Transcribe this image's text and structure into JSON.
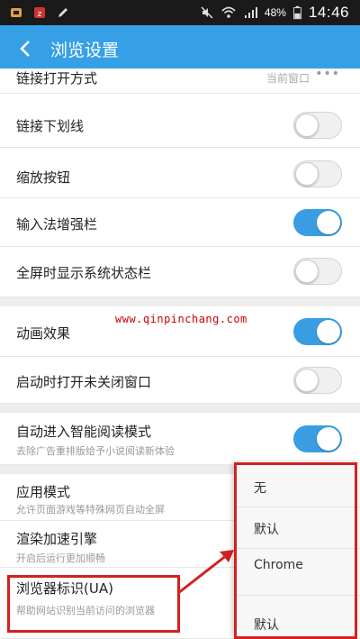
{
  "status_bar": {
    "battery": "48%",
    "time": "14:46"
  },
  "header": {
    "title": "浏览设置"
  },
  "rows": [
    {
      "label": "链接打开方式",
      "value": "当前窗口"
    },
    {
      "label": "链接下划线",
      "toggle": "off"
    },
    {
      "label": "缩放按钮",
      "toggle": "off"
    },
    {
      "label": "输入法增强栏",
      "toggle": "on"
    },
    {
      "label": "全屏时显示系统状态栏",
      "toggle": "off"
    },
    {
      "label": "动画效果",
      "toggle": "on"
    },
    {
      "label": "启动时打开未关闭窗口",
      "toggle": "off"
    },
    {
      "label": "自动进入智能阅读模式",
      "sub": "去除广告重排版给予小说阅读新体验",
      "toggle": "on"
    },
    {
      "label": "应用模式",
      "sub": "允许页面游戏等特殊网页自动全屏"
    },
    {
      "label": "渲染加速引擎",
      "sub": "开启后运行更加顺畅"
    },
    {
      "label": "浏览器标识(UA)",
      "sub": "帮助网站识别当前访问的浏览器"
    }
  ],
  "watermark": "www.qinpinchang.com",
  "ua_dropdown": {
    "options": [
      "无",
      "默认",
      "Chrome",
      "默认"
    ]
  },
  "colors": {
    "accent": "#36a0e6",
    "toggle_on": "#3a9de2",
    "annotation": "#d42020"
  }
}
